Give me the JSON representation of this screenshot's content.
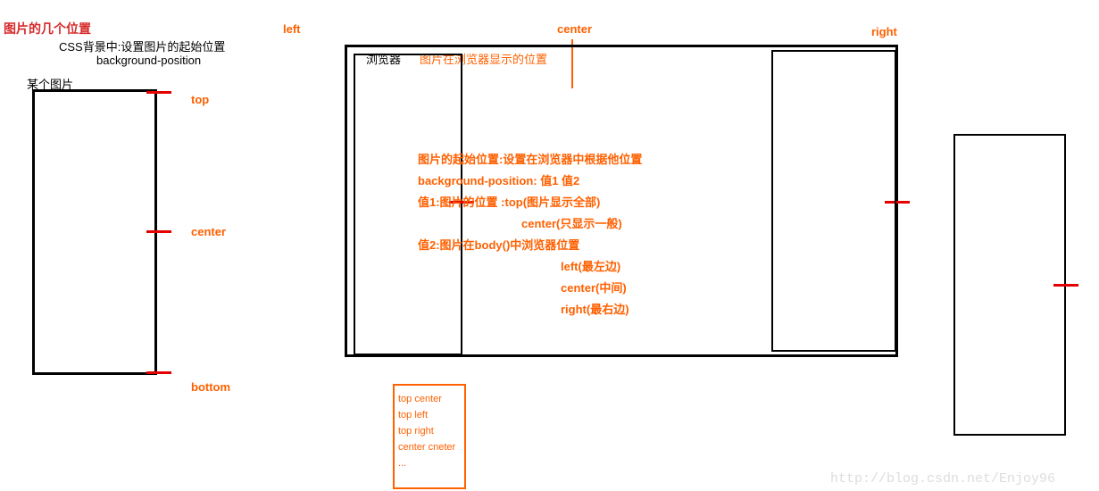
{
  "left_panel": {
    "title": "图片的几个位置",
    "sub1": "CSS背景中:设置图片的起始位置",
    "sub2": "background-position",
    "img_label": "某个图片",
    "pos_top": "top",
    "pos_center": "center",
    "pos_bottom": "bottom"
  },
  "top_labels": {
    "left": "left",
    "center": "center",
    "right": "right"
  },
  "browser": {
    "label": "浏览器",
    "caption": "图片在浏览器显示的位置"
  },
  "desc": {
    "l1": "图片的起始位置:设置在浏览器中根据他位置",
    "l2": "background-position: 值1 值2",
    "l3": "值1:图片的位置 :top(图片显示全部)",
    "l4": "center(只显示一般)",
    "l5": "值2:图片在body()中浏览器位置",
    "l6": "left(最左边)",
    "l7": "center(中间)",
    "l8": "right(最右边)"
  },
  "combo": {
    "i1": "top  center",
    "i2": "top left",
    "i3": "top right",
    "i4": "center cneter",
    "i5": "..."
  },
  "watermark": "http://blog.csdn.net/Enjoy96"
}
